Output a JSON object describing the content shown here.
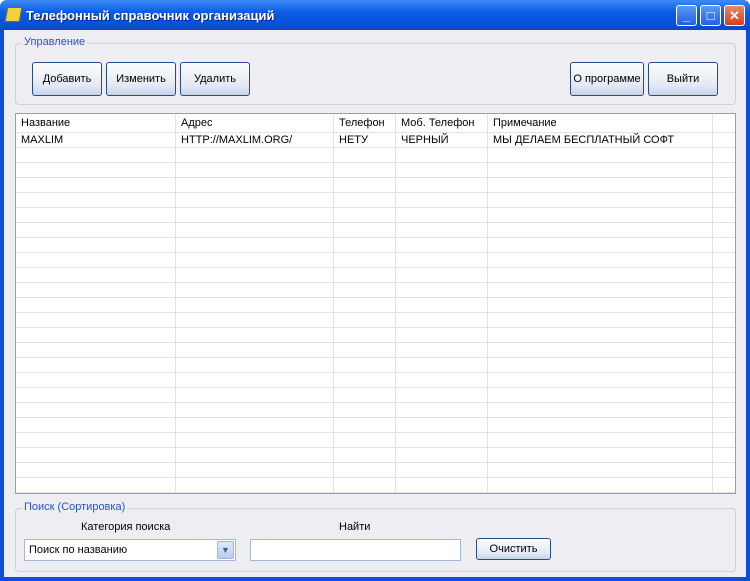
{
  "window": {
    "title": "Телефонный справочник организаций",
    "min": "_",
    "max": "□",
    "close": "✕"
  },
  "control_group": {
    "label": "Управление",
    "add": "Добавить",
    "edit": "Изменить",
    "delete": "Удалить",
    "about": "О программе",
    "exit": "Выйти"
  },
  "table": {
    "columns": [
      "Название",
      "Адрес",
      "Телефон",
      "Моб. Телефон",
      "Примечание"
    ],
    "rows": [
      [
        "MAXLIM",
        "HTTP://MAXLIM.ORG/",
        "НЕТУ",
        "ЧЕРНЫЙ",
        "МЫ ДЕЛАЕМ БЕСПЛАТНЫЙ СОФТ"
      ]
    ]
  },
  "search_group": {
    "label": "Поиск (Сортировка)",
    "category_label": "Категория поиска",
    "category_value": "Поиск по названию",
    "find_label": "Найти",
    "find_value": "",
    "clear": "Очистить"
  }
}
